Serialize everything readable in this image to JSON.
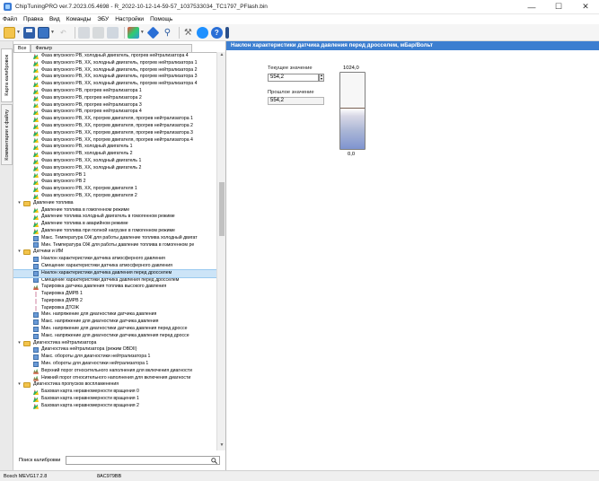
{
  "window": {
    "title": "ChipTuningPRO ver.7.2023.05.4698 - R_2022-10-12-14-59-57_1037533034_TC1797_PFlash.bin"
  },
  "menu": [
    "Файл",
    "Правка",
    "Вид",
    "Команды",
    "ЭБУ",
    "Настройки",
    "Помощь"
  ],
  "side_tabs": {
    "calib_map": "Карта калибровок",
    "file_comments": "Комментарии к файлу"
  },
  "left_tabs": {
    "all": "Все",
    "filter": "Фильтр"
  },
  "tree": [
    {
      "icon": "3d",
      "indent": 1,
      "label": "Фаза впускного РВ, холодный двигатель, прогрев нейтрализатора 4"
    },
    {
      "icon": "3d",
      "indent": 1,
      "label": "Фаза впускного РВ, ХХ, холодный двигатель, прогрев нейтрализатора 1"
    },
    {
      "icon": "3d",
      "indent": 1,
      "label": "Фаза впускного РВ, ХХ, холодный двигатель, прогрев нейтрализатора 2"
    },
    {
      "icon": "3d",
      "indent": 1,
      "label": "Фаза впускного РВ, ХХ, холодный двигатель, прогрев нейтрализатора 3"
    },
    {
      "icon": "3d",
      "indent": 1,
      "label": "Фаза впускного РВ, ХХ, холодный двигатель, прогрев нейтрализатора 4"
    },
    {
      "icon": "3d",
      "indent": 1,
      "label": "Фаза впускного РВ, прогрев нейтрализатора 1"
    },
    {
      "icon": "3d",
      "indent": 1,
      "label": "Фаза впускного РВ, прогрев нейтрализатора 2"
    },
    {
      "icon": "3d",
      "indent": 1,
      "label": "Фаза впускного РВ, прогрев нейтрализатора 3"
    },
    {
      "icon": "3d",
      "indent": 1,
      "label": "Фаза впускного РВ, прогрев нейтрализатора 4"
    },
    {
      "icon": "3d",
      "indent": 1,
      "label": "Фаза впускного РВ, ХХ, прогрев двигателя, прогрев нейтрализатора 1"
    },
    {
      "icon": "3d",
      "indent": 1,
      "label": "Фаза впускного РВ, ХХ, прогрев двигателя, прогрев нейтрализатора 2"
    },
    {
      "icon": "3d",
      "indent": 1,
      "label": "Фаза впускного РВ, ХХ, прогрев двигателя, прогрев нейтрализатора 3"
    },
    {
      "icon": "3d",
      "indent": 1,
      "label": "Фаза впускного РВ, ХХ, прогрев двигателя, прогрев нейтрализатора 4"
    },
    {
      "icon": "3d",
      "indent": 1,
      "label": "Фаза впускного РВ, холодный двигатель 1"
    },
    {
      "icon": "3d",
      "indent": 1,
      "label": "Фаза впускного РВ, холодный двигатель 2"
    },
    {
      "icon": "3d",
      "indent": 1,
      "label": "Фаза впускного РВ, ХХ, холодный двигатель 1"
    },
    {
      "icon": "3d",
      "indent": 1,
      "label": "Фаза впускного РВ, ХХ, холодный двигатель 2"
    },
    {
      "icon": "3d",
      "indent": 1,
      "label": "Фаза впускного РВ 1"
    },
    {
      "icon": "3d",
      "indent": 1,
      "label": "Фаза впускного РВ 2"
    },
    {
      "icon": "3d",
      "indent": 1,
      "label": "Фаза впускного РВ, ХХ, прогрев двигателя 1"
    },
    {
      "icon": "3d",
      "indent": 1,
      "label": "Фаза впускного РВ, ХХ, прогрев двигателя 2"
    },
    {
      "icon": "folder",
      "indent": 0,
      "label": "Давление топлива"
    },
    {
      "icon": "3d",
      "indent": 1,
      "label": "Давление топлива в гомогенном режиме"
    },
    {
      "icon": "3d",
      "indent": 1,
      "label": "Давление топлива холодный двигатель в гомогенном режиме"
    },
    {
      "icon": "3d",
      "indent": 1,
      "label": "Давление топлива в аварийном режиме"
    },
    {
      "icon": "3d",
      "indent": 1,
      "label": "Давление топлива при полной нагрузке в гомогенном режиме"
    },
    {
      "icon": "tbl",
      "indent": 1,
      "label": "Макс. Температура ОЖ для работы давление топлива холодный двигат"
    },
    {
      "icon": "tbl",
      "indent": 1,
      "label": "Мин. Температура ОЖ для работы давление топлива в гомогенном ре"
    },
    {
      "icon": "folder",
      "indent": 0,
      "label": "Датчики и ИМ"
    },
    {
      "icon": "tbl",
      "indent": 1,
      "label": "Наклон характеристики датчика атмосферного давления"
    },
    {
      "icon": "tbl",
      "indent": 1,
      "label": "Смещение характеристики датчика атмосферного давления"
    },
    {
      "icon": "tbl",
      "indent": 1,
      "label": "Наклон характеристики датчика давления перед дросселем",
      "selected": true
    },
    {
      "icon": "tbl",
      "indent": 1,
      "label": "Смещение характеристики датчика давления перед дросселем"
    },
    {
      "icon": "2d",
      "indent": 1,
      "label": "Тарировка датчика давления топлива высокого давления"
    },
    {
      "icon": "line",
      "indent": 1,
      "label": "Тарировка ДМРВ 1"
    },
    {
      "icon": "line",
      "indent": 1,
      "label": "Тарировка ДМРВ 2"
    },
    {
      "icon": "line",
      "indent": 1,
      "label": "Тарировка ДТОЖ"
    },
    {
      "icon": "tbl",
      "indent": 1,
      "label": "Мин. напряжение для диагностики датчика давления"
    },
    {
      "icon": "tbl",
      "indent": 1,
      "label": "Макс. напряжение для диагностики датчика давления"
    },
    {
      "icon": "tbl",
      "indent": 1,
      "label": "Мин. напряжение для диагностики датчика давления перед дроссе"
    },
    {
      "icon": "tbl",
      "indent": 1,
      "label": "Макс. напряжение для диагностики датчика давления перед дроссе"
    },
    {
      "icon": "folder",
      "indent": 0,
      "label": "Диагностика нейтрализатора"
    },
    {
      "icon": "tbl",
      "indent": 1,
      "label": "Диагностика нейтрализатора (режим OBDII)"
    },
    {
      "icon": "tbl",
      "indent": 1,
      "label": "Макс. обороты для диагностики нейтрализатора 1"
    },
    {
      "icon": "tbl",
      "indent": 1,
      "label": "Мин. обороты для диагностики нейтрализатора 1"
    },
    {
      "icon": "2d",
      "indent": 1,
      "label": "Верхний порог относительного наполнения для включения диагности"
    },
    {
      "icon": "2d",
      "indent": 1,
      "label": "Нижний порог относительного наполнения для включения диагности"
    },
    {
      "icon": "folder",
      "indent": 0,
      "label": "Диагностика пропусков воспламенения"
    },
    {
      "icon": "3d",
      "indent": 1,
      "label": "Базовая карта неравномерности вращения 0"
    },
    {
      "icon": "3d",
      "indent": 1,
      "label": "Базовая карта неравномерности вращения 1"
    },
    {
      "icon": "3d",
      "indent": 1,
      "label": "Базовая карта неравномерности вращения 2"
    }
  ],
  "search": {
    "label": "Поиск калибровки",
    "value": ""
  },
  "editor": {
    "header": "Наклон характеристики датчика давления перед дросселем, мБар/Вольт",
    "current_label": "Текущее значение",
    "current_value": "554,2",
    "previous_label": "Прошлое значение",
    "previous_value": "554,2",
    "gauge_max": "1024,0",
    "gauge_min": "0,0",
    "gauge_level": 0.541
  },
  "status": {
    "ecu": "Bosch MEVG17.2.8",
    "checksum": "8AC979BB"
  }
}
